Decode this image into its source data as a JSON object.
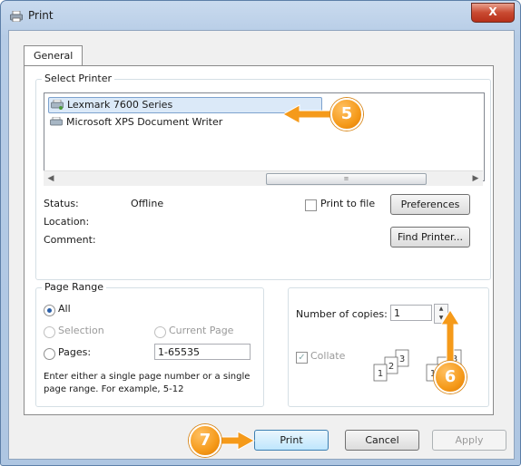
{
  "window": {
    "title": "Print",
    "close_label": "X"
  },
  "tabs": [
    {
      "label": "General"
    }
  ],
  "select_printer": {
    "label": "Select Printer",
    "printers": [
      {
        "name": "Lexmark 7600 Series"
      },
      {
        "name": "Microsoft XPS Document Writer"
      }
    ]
  },
  "info": {
    "status_label": "Status:",
    "status_value": "Offline",
    "location_label": "Location:",
    "comment_label": "Comment:",
    "print_to_file_label": "Print to file",
    "preferences_label": "Preferences",
    "find_printer_label": "Find Printer..."
  },
  "page_range": {
    "label": "Page Range",
    "all_label": "All",
    "selection_label": "Selection",
    "current_page_label": "Current Page",
    "pages_label": "Pages:",
    "pages_value": "1-65535",
    "hint_line1": "Enter either a single page number or a single",
    "hint_line2": "page range.  For example, 5-12"
  },
  "copies": {
    "label": "Number of copies:",
    "value": "1",
    "collate_label": "Collate",
    "collate_checked": true,
    "collate_pages": [
      "1",
      "2",
      "3",
      "1",
      "2",
      "3"
    ]
  },
  "footer": {
    "print_label": "Print",
    "cancel_label": "Cancel",
    "apply_label": "Apply"
  },
  "callouts": {
    "step5": "5",
    "step6": "6",
    "step7": "7"
  },
  "colors": {
    "callout": "#f59a1a",
    "accent": "#3c7fb1"
  }
}
